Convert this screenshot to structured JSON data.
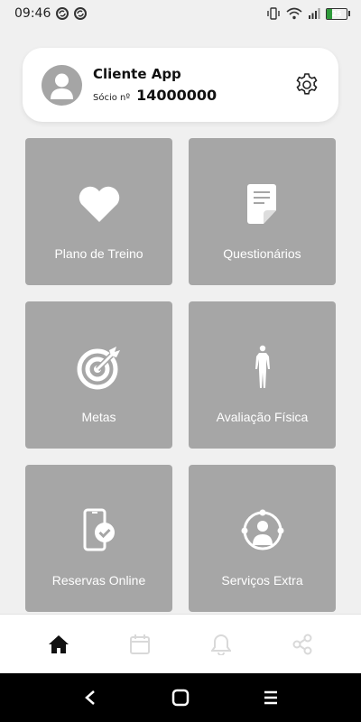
{
  "status_bar": {
    "time": "09:46",
    "battery_level": "25",
    "icons": [
      "sync-icon",
      "sync-icon",
      "vibrate-icon",
      "wifi-icon",
      "signal-icon",
      "battery-icon"
    ]
  },
  "profile": {
    "name": "Cliente App",
    "member_label": "Sócio nº",
    "member_number": "14000000",
    "icons": [
      "avatar-icon",
      "gear-icon"
    ]
  },
  "tiles": [
    {
      "label": "Plano de Treino",
      "icon": "heart-icon"
    },
    {
      "label": "Questionários",
      "icon": "document-icon"
    },
    {
      "label": "Metas",
      "icon": "target-icon"
    },
    {
      "label": "Avaliação Física",
      "icon": "body-icon"
    },
    {
      "label": "Reservas Online",
      "icon": "phone-check-icon"
    },
    {
      "label": "Serviços Extra",
      "icon": "user-network-icon"
    }
  ],
  "bottom_nav": {
    "items": [
      "home-icon",
      "calendar-icon",
      "bell-icon",
      "share-icon"
    ],
    "active": "home-icon"
  },
  "colors": {
    "tile": "#a6a6a6",
    "background": "#f0f0f0",
    "nav_inactive": "#d9d9d9",
    "battery": "#2e9a3a"
  }
}
